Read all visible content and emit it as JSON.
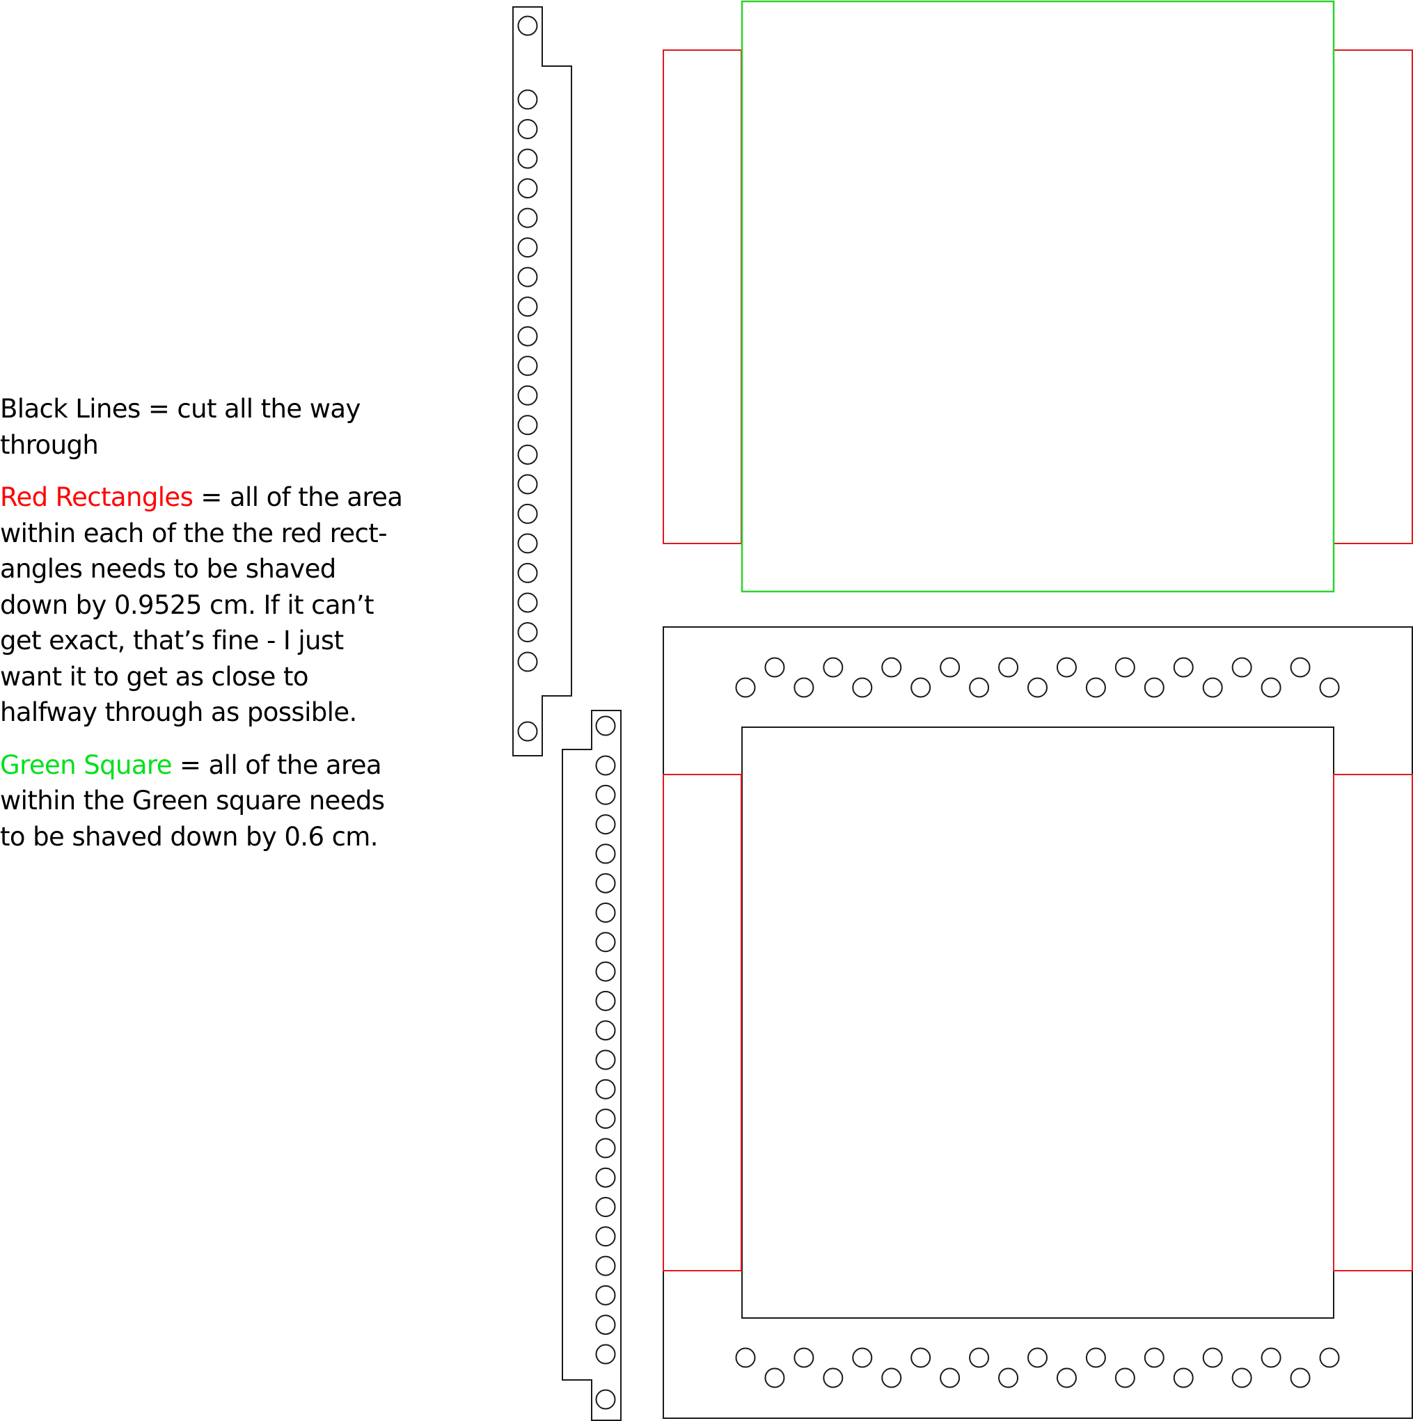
{
  "legend": {
    "black": {
      "term": "Black Lines",
      "description": " = cut all the way through"
    },
    "red": {
      "term": "Red Rectangles",
      "description": " = all of the area within each of the the red rect-angles needs to be shaved down by 0.9525 cm. If it can’t get exact, that’s fine - I just want it to get as close to halfway through as possible."
    },
    "green": {
      "term": "Green Square",
      "description": " = all of the area within the Green square needs to be shaved down by 0.6 cm."
    }
  },
  "colors": {
    "cut": "#1a1a1a",
    "shave_red": "#ff0000",
    "shave_green": "#00e01a"
  },
  "specs": {
    "red_shave_depth_cm": 0.9525,
    "green_shave_depth_cm": 0.6
  },
  "parts": {
    "strip_top": {
      "hole_count": 22
    },
    "strip_bottom": {
      "hole_count": 23
    },
    "top_panel": {
      "red_rectangles": 2,
      "green_squares": 1
    },
    "bottom_frame": {
      "red_rectangles": 2,
      "top_row_holes": 21,
      "bottom_row_holes": 21
    }
  }
}
